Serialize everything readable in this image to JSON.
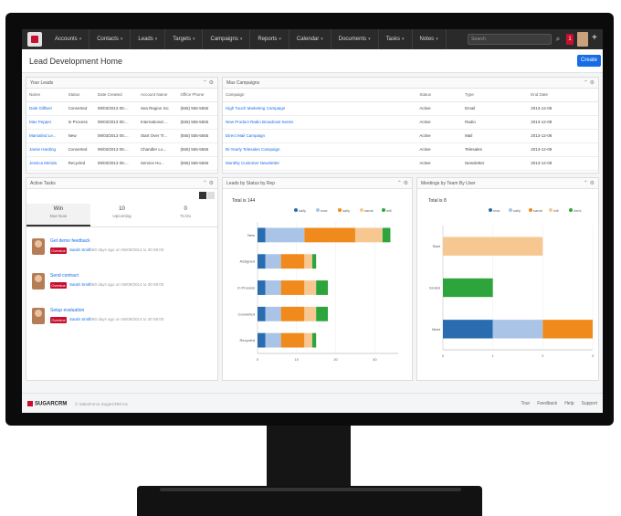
{
  "nav": {
    "items": [
      "Accounts",
      "Contacts",
      "Leads",
      "Targets",
      "Campaigns",
      "Reports",
      "Calendar",
      "Documents",
      "Tasks",
      "Notes"
    ],
    "search_placeholder": "Search",
    "notif_count": "1"
  },
  "page": {
    "title": "Lead Development Home",
    "create_label": "Create"
  },
  "my_leads": {
    "title": "Your Leads",
    "columns": [
      "Name",
      "Status",
      "Date Created",
      "Account Name",
      "Office Phone"
    ],
    "rows": [
      [
        "Dale Gillbert",
        "Converted",
        "09/03/2013 05:...",
        "Sea Region Inc",
        "(555) 555-5555"
      ],
      [
        "Max Pepper",
        "In Process",
        "09/03/2013 05:...",
        "International ...",
        "(555) 555-5555"
      ],
      [
        "Marsalind Le...",
        "New",
        "09/03/2013 05:...",
        "Start Over Tr...",
        "(555) 555-5555"
      ],
      [
        "Jamie Harding",
        "Converted",
        "09/03/2013 05:...",
        "Chandler Lo...",
        "(555) 555-5555"
      ],
      [
        "Jessica Merida",
        "Recycled",
        "09/03/2013 05:...",
        "Service Ho...",
        "(555) 555-5555"
      ]
    ]
  },
  "campaigns": {
    "title": "Max Campaigns",
    "columns": [
      "Campaign",
      "Status",
      "Type",
      "End Date"
    ],
    "rows": [
      [
        "High Touch Marketing Campaign",
        "Active",
        "Email",
        "2013-12-08"
      ],
      [
        "New Product Radio Broadcast Series",
        "Active",
        "Radio",
        "2013-12-08"
      ],
      [
        "Direct Mail Campaign",
        "Active",
        "Mail",
        "2013-12-08"
      ],
      [
        "Bi-Yearly Telesales Campaign",
        "Active",
        "Telesales",
        "2013-12-08"
      ],
      [
        "Monthly Customer Newsletter",
        "Active",
        "Newsletter",
        "2013-12-08"
      ]
    ]
  },
  "tasks": {
    "title": "Active Tasks",
    "tabs": [
      {
        "count": "Win",
        "label": "Due Now"
      },
      {
        "count": "10",
        "label": "Upcoming"
      },
      {
        "count": "0",
        "label": "To Do"
      }
    ],
    "items": [
      {
        "title": "Get demo feedback",
        "badge": "Overdue",
        "user": "Sarah Smith",
        "meta": "80 days ago on 06/09/2014 to 30 08:00"
      },
      {
        "title": "Send contract",
        "badge": "Overdue",
        "user": "Sarah Smith",
        "meta": "80 days ago on 06/09/2014 to 30 08:00"
      },
      {
        "title": "Setup evaluation",
        "badge": "Overdue",
        "user": "Sarah Smith",
        "meta": "80 days ago on 06/09/2014 to 30 08:00"
      }
    ]
  },
  "leads_chart_panel": {
    "title": "Leads by Status by Rep"
  },
  "meetings_chart_panel": {
    "title": "Meetings by Team By User"
  },
  "footer": {
    "brand": "SUGARCRM",
    "sub": "© SalesForce SugarCRM Inc",
    "links": [
      "Tour",
      "Feedback",
      "Help",
      "Support"
    ]
  },
  "colors": {
    "blue": "#2a6cb0",
    "lightblue": "#a9c4e7",
    "orange": "#f08a1c",
    "peach": "#f7c792",
    "green": "#2ea43c",
    "red": "#c8102e"
  },
  "chart_data": [
    {
      "type": "bar",
      "orientation": "horizontal",
      "stacked": true,
      "title": "Total is 144",
      "categories": [
        "New",
        "Assigned",
        "In Process",
        "Converted",
        "Recycled"
      ],
      "series": [
        {
          "name": "sally",
          "color": "#2a6cb0",
          "values": [
            2,
            2,
            2,
            2,
            2
          ]
        },
        {
          "name": "max",
          "color": "#a9c4e7",
          "values": [
            10,
            4,
            4,
            4,
            4
          ]
        },
        {
          "name": "sally",
          "color": "#f08a1c",
          "values": [
            13,
            6,
            6,
            6,
            6
          ]
        },
        {
          "name": "sarah",
          "color": "#f7c792",
          "values": [
            7,
            2,
            3,
            3,
            2
          ]
        },
        {
          "name": "will",
          "color": "#2ea43c",
          "values": [
            2,
            1,
            3,
            3,
            1
          ]
        }
      ],
      "xticks": [
        "0",
        "10",
        "20",
        "30"
      ],
      "xlim": [
        0,
        36
      ],
      "legend": "top-right"
    },
    {
      "type": "bar",
      "orientation": "horizontal",
      "stacked": true,
      "title": "Total is 8",
      "categories": [
        "Start",
        "Ended",
        "Meet"
      ],
      "series": [
        {
          "name": "max",
          "color": "#2a6cb0",
          "values": [
            0,
            0,
            1
          ]
        },
        {
          "name": "sally",
          "color": "#a9c4e7",
          "values": [
            0,
            0,
            1
          ]
        },
        {
          "name": "sarah",
          "color": "#f08a1c",
          "values": [
            0,
            0,
            1
          ]
        },
        {
          "name": "will",
          "color": "#f7c792",
          "values": [
            2,
            0,
            0
          ]
        },
        {
          "name": "chris",
          "color": "#2ea43c",
          "values": [
            0,
            1,
            0
          ]
        }
      ],
      "xticks": [
        "0",
        "1",
        "2",
        "3"
      ],
      "xlim": [
        0,
        3
      ],
      "legend": "top-right"
    }
  ]
}
